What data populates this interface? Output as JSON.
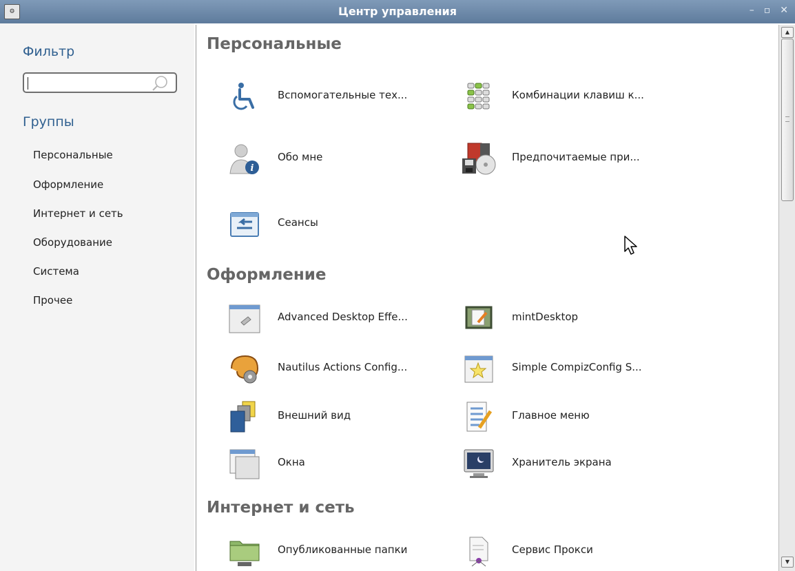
{
  "window": {
    "title": "Центр управления",
    "app_icon_text": "⚙",
    "minimize": "–",
    "maximize": "▫",
    "close": "✕"
  },
  "sidebar": {
    "filter_heading": "Фильтр",
    "search": {
      "value": "",
      "placeholder": ""
    },
    "groups_heading": "Группы",
    "groups": [
      "Персональные",
      "Оформление",
      "Интернет и сеть",
      "Оборудование",
      "Система",
      "Прочее"
    ]
  },
  "sections": [
    {
      "title": "Персональные",
      "items": [
        {
          "label": "Вспомогательные тех...",
          "icon": "accessibility-icon"
        },
        {
          "label": "Комбинации клавиш к...",
          "icon": "keyboard-shortcuts-icon"
        },
        {
          "label": "Обо мне",
          "icon": "about-me-icon"
        },
        {
          "label": "Предпочитаемые при...",
          "icon": "preferred-applications-icon"
        },
        {
          "label": "Сеансы",
          "icon": "sessions-icon"
        }
      ]
    },
    {
      "title": "Оформление",
      "items": [
        {
          "label": "Advanced Desktop Effe...",
          "icon": "desktop-effects-icon"
        },
        {
          "label": "mintDesktop",
          "icon": "mintdesktop-icon"
        },
        {
          "label": "Nautilus Actions Config...",
          "icon": "nautilus-actions-icon"
        },
        {
          "label": "Simple CompizConfig S...",
          "icon": "compizconfig-icon"
        },
        {
          "label": "Внешний вид",
          "icon": "appearance-icon"
        },
        {
          "label": "Главное меню",
          "icon": "main-menu-icon"
        },
        {
          "label": "Окна",
          "icon": "windows-icon"
        },
        {
          "label": "Хранитель экрана",
          "icon": "screensaver-icon"
        }
      ]
    },
    {
      "title": "Интернет и сеть",
      "items": [
        {
          "label": "Опубликованные папки",
          "icon": "shared-folders-icon"
        },
        {
          "label": "Сервис Прокси",
          "icon": "proxy-service-icon"
        }
      ]
    }
  ],
  "colors": {
    "titlebar": "#6b86a6",
    "sidebar_heading": "#2f5f8f",
    "section_title": "#666666"
  }
}
